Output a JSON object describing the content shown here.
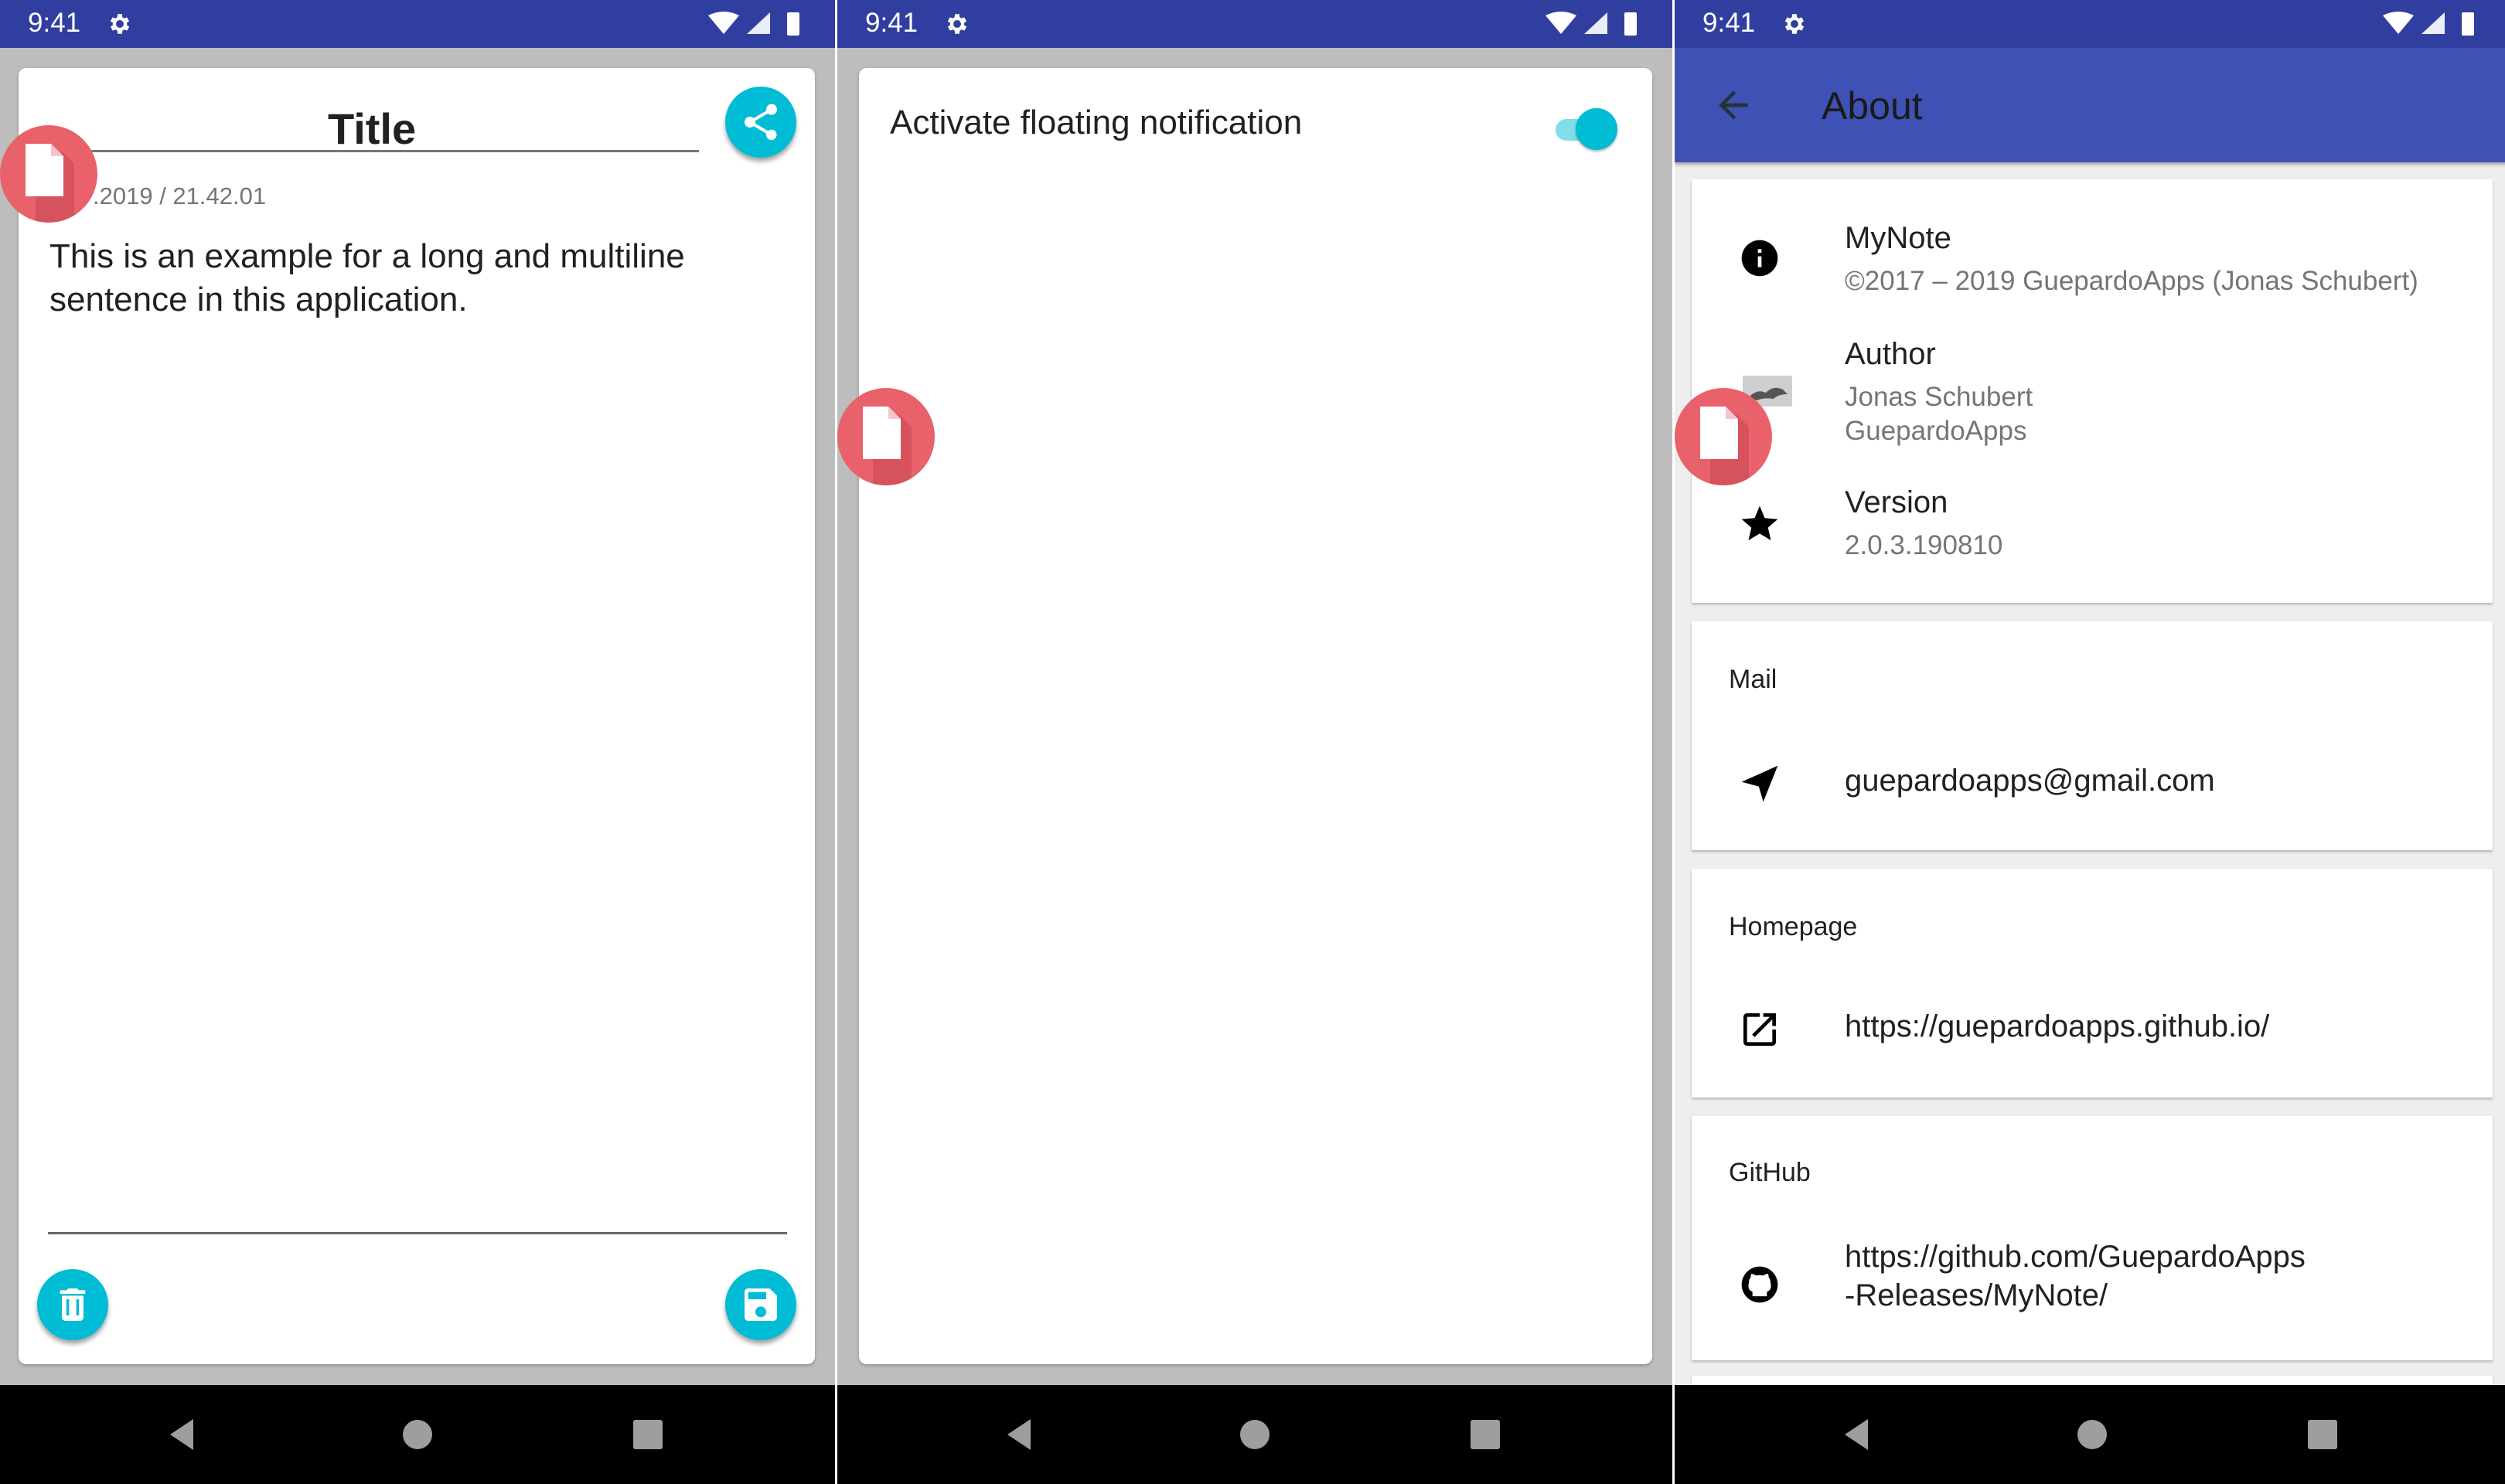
{
  "status_bar": {
    "time": "9:41"
  },
  "screen_note": {
    "title": "Title",
    "date": ".2019 / 21.42.01",
    "content": "This is an example for a long and multiline sentence in this application."
  },
  "screen_settings": {
    "setting_label": "Activate floating notification",
    "toggle_on": true
  },
  "screen_about": {
    "toolbar_title": "About",
    "app": {
      "name": "MyNote",
      "copyright": "©2017 – 2019 GuepardoApps (Jonas Schubert)"
    },
    "author": {
      "label": "Author",
      "name": "Jonas Schubert",
      "company": "GuepardoApps"
    },
    "version": {
      "label": "Version",
      "value": "2.0.3.190810"
    },
    "mail": {
      "header": "Mail",
      "value": "guepardoapps@gmail.com"
    },
    "homepage": {
      "header": "Homepage",
      "value": "https://guepardoapps.github.io/"
    },
    "github": {
      "header": "GitHub",
      "line1": "https://github.com/GuepardoApps",
      "line2": "-Releases/MyNote/"
    }
  },
  "colors": {
    "status_bar": "#303f9f",
    "app_bar": "#3f51b5",
    "accent": "#00bcd4",
    "bubble": "#e8616b"
  },
  "icons": [
    "settings-icon",
    "wifi-icon",
    "signal-icon",
    "battery-icon",
    "share-icon",
    "delete-icon",
    "save-icon",
    "floating-note-icon",
    "back-arrow-icon",
    "info-icon",
    "author-avatar",
    "star-icon",
    "send-icon",
    "open-external-icon",
    "github-icon",
    "nav-back-icon",
    "nav-home-icon",
    "nav-recents-icon"
  ]
}
